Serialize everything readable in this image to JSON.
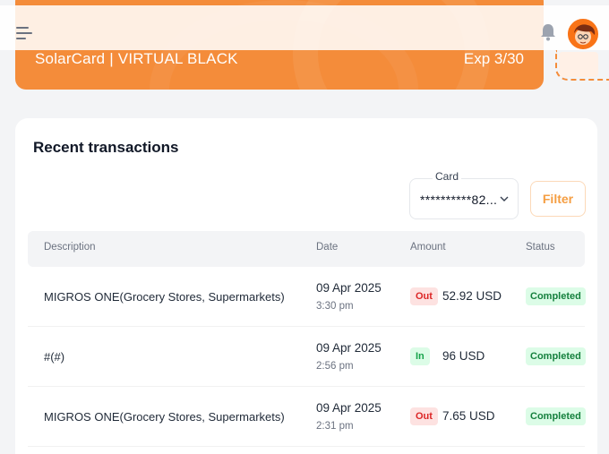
{
  "card_banner": {
    "name": "SolarCard | VIRTUAL BLACK",
    "expiry": "Exp 3/30",
    "color": "#f48c3a"
  },
  "header": {
    "menu_icon": "hamburger-menu-icon",
    "notification_icon": "bell-icon",
    "avatar_icon": "user-avatar"
  },
  "transactions": {
    "title": "Recent transactions",
    "card_select": {
      "label": "Card",
      "value": "**********82..."
    },
    "filter_label": "Filter",
    "columns": [
      "Description",
      "Date",
      "Amount",
      "Status"
    ],
    "rows": [
      {
        "description": "MIGROS ONE(Grocery Stores, Supermarkets)",
        "date": "09 Apr 2025",
        "time": "3:30 pm",
        "direction": "Out",
        "amount": "52.92 USD",
        "status": "Completed"
      },
      {
        "description": "#(#)",
        "date": "09 Apr 2025",
        "time": "2:56 pm",
        "direction": "In",
        "amount": "96 USD",
        "status": "Completed"
      },
      {
        "description": "MIGROS ONE(Grocery Stores, Supermarkets)",
        "date": "09 Apr 2025",
        "time": "2:31 pm",
        "direction": "Out",
        "amount": "7.65 USD",
        "status": "Completed"
      }
    ]
  },
  "colors": {
    "accent": "#f48c3a",
    "out_badge": "#dc2626",
    "in_badge": "#16a34a",
    "completed": "#15803d"
  }
}
